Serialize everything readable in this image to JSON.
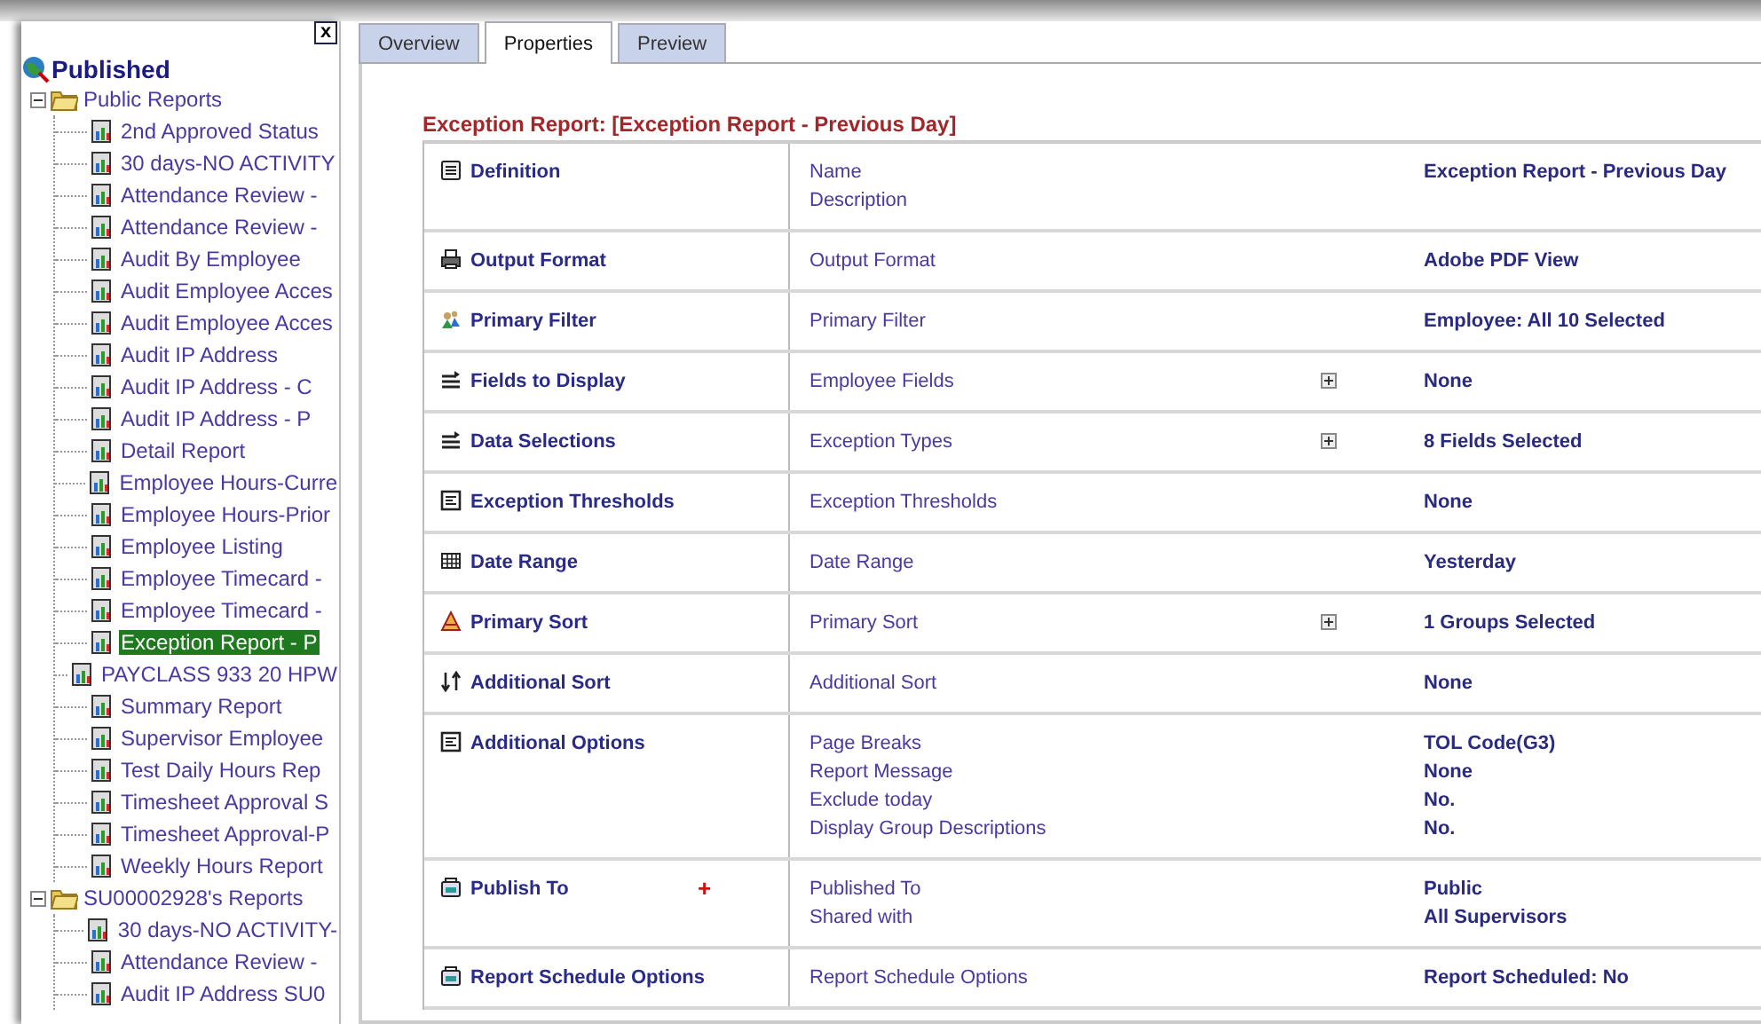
{
  "tree": {
    "label": "Published",
    "children": [
      {
        "label": "Public Reports",
        "expanded": true,
        "children": [
          {
            "label": "2nd Approved Status",
            "selected": false
          },
          {
            "label": "30 days-NO ACTIVITY",
            "selected": false
          },
          {
            "label": "Attendance Review -",
            "selected": false
          },
          {
            "label": "Attendance Review -",
            "selected": false
          },
          {
            "label": "Audit By Employee",
            "selected": false
          },
          {
            "label": "Audit Employee Acces",
            "selected": false
          },
          {
            "label": "Audit Employee Acces",
            "selected": false
          },
          {
            "label": "Audit IP Address",
            "selected": false
          },
          {
            "label": "Audit IP Address - C",
            "selected": false
          },
          {
            "label": "Audit IP Address - P",
            "selected": false
          },
          {
            "label": "Detail Report",
            "selected": false
          },
          {
            "label": "Employee Hours-Curre",
            "selected": false
          },
          {
            "label": "Employee Hours-Prior",
            "selected": false
          },
          {
            "label": "Employee Listing",
            "selected": false
          },
          {
            "label": "Employee Timecard -",
            "selected": false
          },
          {
            "label": "Employee Timecard -",
            "selected": false
          },
          {
            "label": "Exception Report - P",
            "selected": true
          },
          {
            "label": "PAYCLASS 933 20 HPW",
            "selected": false
          },
          {
            "label": "Summary Report",
            "selected": false
          },
          {
            "label": "Supervisor Employee",
            "selected": false
          },
          {
            "label": "Test Daily Hours Rep",
            "selected": false
          },
          {
            "label": "Timesheet Approval S",
            "selected": false
          },
          {
            "label": "Timesheet Approval-P",
            "selected": false
          },
          {
            "label": "Weekly Hours Report",
            "selected": false
          }
        ]
      },
      {
        "label": "SU00002928's Reports",
        "expanded": true,
        "children": [
          {
            "label": "30 days-NO ACTIVITY-",
            "selected": false
          },
          {
            "label": "Attendance Review -",
            "selected": false
          },
          {
            "label": "Audit IP Address SU0",
            "selected": false
          }
        ]
      }
    ]
  },
  "close_button": "x",
  "tabs": [
    {
      "label": "Overview",
      "selected": false
    },
    {
      "label": "Properties",
      "selected": true
    },
    {
      "label": "Preview",
      "selected": false
    }
  ],
  "heading": "Exception Report: [Exception Report - Previous Day]",
  "rows": [
    {
      "kind": "document",
      "label": "Definition",
      "fields": [
        "Name",
        "Description"
      ],
      "expandable": false,
      "values": [
        "Exception Report - Previous Day"
      ]
    },
    {
      "kind": "printer",
      "label": "Output Format",
      "fields": [
        "Output Format"
      ],
      "expandable": false,
      "values": [
        "Adobe PDF View"
      ]
    },
    {
      "kind": "people",
      "label": "Primary Filter",
      "fields": [
        "Primary Filter"
      ],
      "expandable": false,
      "values": [
        "Employee: All 10 Selected"
      ]
    },
    {
      "kind": "list",
      "label": "Fields to Display",
      "fields": [
        "Employee Fields"
      ],
      "expandable": true,
      "values": [
        "None"
      ]
    },
    {
      "kind": "list",
      "label": "Data Selections",
      "fields": [
        "Exception Types"
      ],
      "expandable": true,
      "values": [
        "8 Fields Selected"
      ]
    },
    {
      "kind": "form",
      "label": "Exception Thresholds",
      "fields": [
        "Exception Thresholds"
      ],
      "expandable": false,
      "values": [
        "None"
      ]
    },
    {
      "kind": "calendar",
      "label": "Date Range",
      "fields": [
        "Date Range"
      ],
      "expandable": false,
      "values": [
        "Yesterday"
      ]
    },
    {
      "kind": "pyramid",
      "label": "Primary Sort",
      "fields": [
        "Primary Sort"
      ],
      "expandable": true,
      "values": [
        "1 Groups Selected"
      ]
    },
    {
      "kind": "arrows",
      "label": "Additional Sort",
      "fields": [
        "Additional Sort"
      ],
      "expandable": false,
      "values": [
        "None"
      ]
    },
    {
      "kind": "form",
      "label": "Additional Options",
      "fields": [
        "Page Breaks",
        "Report Message",
        "Exclude today",
        "Display Group Descriptions"
      ],
      "expandable": false,
      "values": [
        "TOL Code(G3)",
        "None",
        "No.",
        "No."
      ]
    },
    {
      "kind": "tray",
      "label": "Publish To",
      "marker": "+",
      "fields": [
        "Published To",
        "Shared with"
      ],
      "expandable": false,
      "values": [
        "Public",
        "All Supervisors"
      ]
    },
    {
      "kind": "tray",
      "label": "Report Schedule Options",
      "fields": [
        "Report Schedule Options"
      ],
      "expandable": false,
      "values": [
        "Report Scheduled: No"
      ]
    }
  ]
}
